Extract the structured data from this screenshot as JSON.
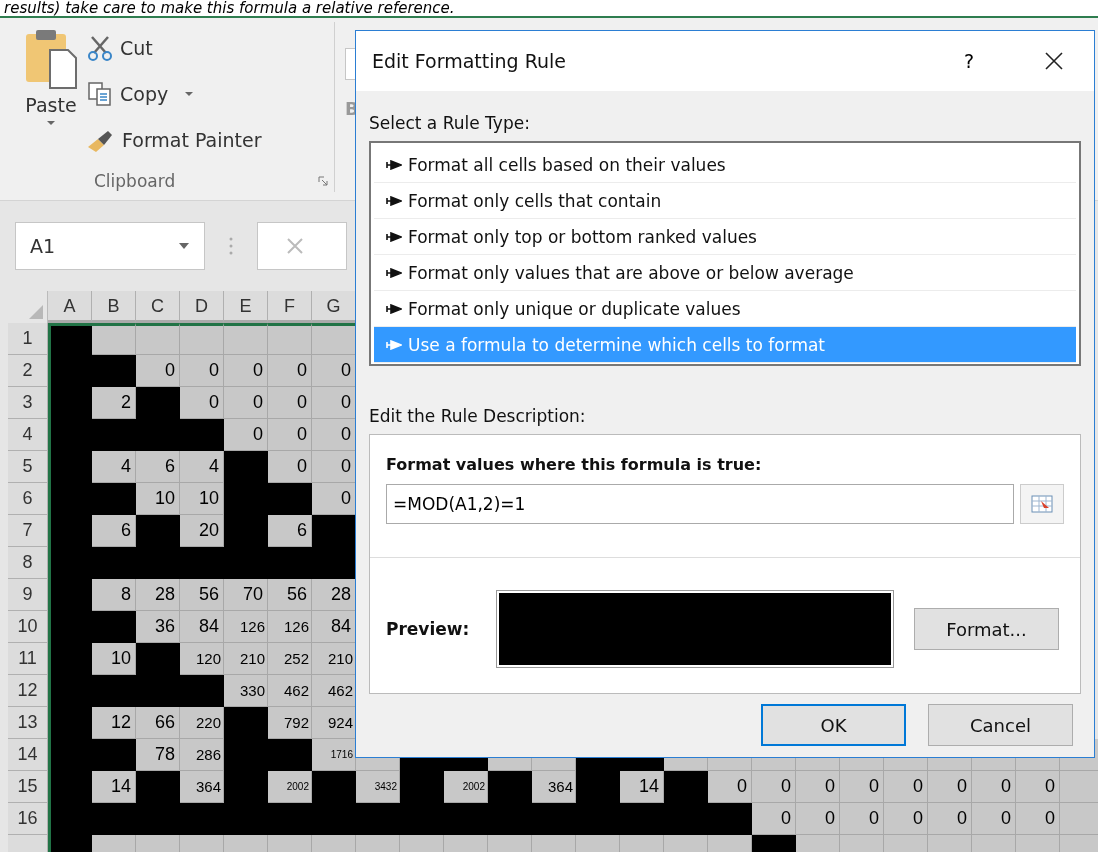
{
  "caption": "results) take care to make this formula a relative reference.",
  "ribbon": {
    "paste": "Paste",
    "cut": "Cut",
    "copy": "Copy",
    "format_painter": "Format Painter",
    "group_label": "Clipboard",
    "next_group_button": "B"
  },
  "name_box": {
    "value": "A1"
  },
  "sheet": {
    "columns": [
      "A",
      "B",
      "C",
      "D",
      "E",
      "F",
      "G"
    ],
    "rows": [
      {
        "header": "1",
        "cells": [
          {
            "filled": true
          },
          {
            "filled": false
          },
          {
            "filled": false
          },
          {
            "filled": false
          },
          {
            "filled": false
          },
          {
            "filled": false
          },
          {
            "filled": false
          }
        ]
      },
      {
        "header": "2",
        "cells": [
          {
            "filled": true
          },
          {
            "filled": true
          },
          {
            "filled": false,
            "value": "0"
          },
          {
            "filled": false,
            "value": "0"
          },
          {
            "filled": false,
            "value": "0"
          },
          {
            "filled": false,
            "value": "0"
          },
          {
            "filled": false,
            "value": "0"
          }
        ]
      },
      {
        "header": "3",
        "cells": [
          {
            "filled": true
          },
          {
            "filled": false,
            "value": "2"
          },
          {
            "filled": true
          },
          {
            "filled": false,
            "value": "0"
          },
          {
            "filled": false,
            "value": "0"
          },
          {
            "filled": false,
            "value": "0"
          },
          {
            "filled": false,
            "value": "0"
          }
        ]
      },
      {
        "header": "4",
        "cells": [
          {
            "filled": true
          },
          {
            "filled": true
          },
          {
            "filled": true
          },
          {
            "filled": true
          },
          {
            "filled": false,
            "value": "0"
          },
          {
            "filled": false,
            "value": "0"
          },
          {
            "filled": false,
            "value": "0"
          }
        ]
      },
      {
        "header": "5",
        "cells": [
          {
            "filled": true
          },
          {
            "filled": false,
            "value": "4"
          },
          {
            "filled": false,
            "value": "6"
          },
          {
            "filled": false,
            "value": "4"
          },
          {
            "filled": true
          },
          {
            "filled": false,
            "value": "0"
          },
          {
            "filled": false,
            "value": "0"
          }
        ]
      },
      {
        "header": "6",
        "cells": [
          {
            "filled": true
          },
          {
            "filled": true
          },
          {
            "filled": false,
            "value": "10"
          },
          {
            "filled": false,
            "value": "10"
          },
          {
            "filled": true
          },
          {
            "filled": true
          },
          {
            "filled": false,
            "value": "0"
          }
        ]
      },
      {
        "header": "7",
        "cells": [
          {
            "filled": true
          },
          {
            "filled": false,
            "value": "6"
          },
          {
            "filled": true
          },
          {
            "filled": false,
            "value": "20"
          },
          {
            "filled": true
          },
          {
            "filled": false,
            "value": "6"
          },
          {
            "filled": true
          }
        ]
      },
      {
        "header": "8",
        "cells": [
          {
            "filled": true
          },
          {
            "filled": true
          },
          {
            "filled": true
          },
          {
            "filled": true
          },
          {
            "filled": true
          },
          {
            "filled": true
          },
          {
            "filled": true
          }
        ]
      },
      {
        "header": "9",
        "cells": [
          {
            "filled": true
          },
          {
            "filled": false,
            "value": "8"
          },
          {
            "filled": false,
            "value": "28"
          },
          {
            "filled": false,
            "value": "56"
          },
          {
            "filled": false,
            "value": "70"
          },
          {
            "filled": false,
            "value": "56"
          },
          {
            "filled": false,
            "value": "28"
          }
        ]
      },
      {
        "header": "10",
        "cells": [
          {
            "filled": true
          },
          {
            "filled": true
          },
          {
            "filled": false,
            "value": "36"
          },
          {
            "filled": false,
            "value": "84"
          },
          {
            "filled": false,
            "value": "126"
          },
          {
            "filled": false,
            "value": "126"
          },
          {
            "filled": false,
            "value": "84"
          }
        ]
      },
      {
        "header": "11",
        "cells": [
          {
            "filled": true
          },
          {
            "filled": false,
            "value": "10"
          },
          {
            "filled": true
          },
          {
            "filled": false,
            "value": "120"
          },
          {
            "filled": false,
            "value": "210"
          },
          {
            "filled": false,
            "value": "252"
          },
          {
            "filled": false,
            "value": "210"
          }
        ]
      },
      {
        "header": "12",
        "cells": [
          {
            "filled": true
          },
          {
            "filled": true
          },
          {
            "filled": true
          },
          {
            "filled": true
          },
          {
            "filled": false,
            "value": "330"
          },
          {
            "filled": false,
            "value": "462"
          },
          {
            "filled": false,
            "value": "462"
          }
        ]
      },
      {
        "header": "13",
        "cells": [
          {
            "filled": true
          },
          {
            "filled": false,
            "value": "12"
          },
          {
            "filled": false,
            "value": "66"
          },
          {
            "filled": false,
            "value": "220"
          },
          {
            "filled": true
          },
          {
            "filled": false,
            "value": "792"
          },
          {
            "filled": false,
            "value": "924"
          }
        ]
      },
      {
        "header": "14",
        "cells": [
          {
            "filled": true
          },
          {
            "filled": true
          },
          {
            "filled": false,
            "value": "78"
          },
          {
            "filled": false,
            "value": "286"
          },
          {
            "filled": true
          },
          {
            "filled": true
          },
          {
            "filled": false,
            "value": "1716"
          },
          {
            "filled": false
          },
          {
            "filled": true
          },
          {
            "filled": true
          },
          {
            "filled": false
          },
          {
            "filled": false
          },
          {
            "filled": true
          },
          {
            "filled": true
          },
          {
            "filled": false
          },
          {
            "filled": false
          },
          {
            "filled": false
          },
          {
            "filled": false
          },
          {
            "filled": false
          },
          {
            "filled": false
          },
          {
            "filled": false
          },
          {
            "filled": false
          },
          {
            "filled": false
          },
          {
            "filled": false
          }
        ]
      },
      {
        "header": "15",
        "cells": [
          {
            "filled": true
          },
          {
            "filled": false,
            "value": "14"
          },
          {
            "filled": true
          },
          {
            "filled": false,
            "value": "364"
          },
          {
            "filled": true
          },
          {
            "filled": false,
            "value": "2002"
          },
          {
            "filled": true
          },
          {
            "filled": false,
            "value": "3432"
          },
          {
            "filled": true
          },
          {
            "filled": false,
            "value": "2002"
          },
          {
            "filled": true
          },
          {
            "filled": false,
            "value": "364"
          },
          {
            "filled": true
          },
          {
            "filled": false,
            "value": "14"
          },
          {
            "filled": true
          },
          {
            "filled": false,
            "value": "0"
          },
          {
            "filled": false,
            "value": "0"
          },
          {
            "filled": false,
            "value": "0"
          },
          {
            "filled": false,
            "value": "0"
          },
          {
            "filled": false,
            "value": "0"
          },
          {
            "filled": false,
            "value": "0"
          },
          {
            "filled": false,
            "value": "0"
          },
          {
            "filled": false,
            "value": "0"
          },
          {
            "filled": false
          }
        ]
      },
      {
        "header": "16",
        "cells": [
          {
            "filled": true
          },
          {
            "filled": true
          },
          {
            "filled": true
          },
          {
            "filled": true
          },
          {
            "filled": true
          },
          {
            "filled": true
          },
          {
            "filled": true
          },
          {
            "filled": true
          },
          {
            "filled": true
          },
          {
            "filled": true
          },
          {
            "filled": true
          },
          {
            "filled": true
          },
          {
            "filled": true
          },
          {
            "filled": true
          },
          {
            "filled": true
          },
          {
            "filled": true
          },
          {
            "filled": false,
            "value": "0"
          },
          {
            "filled": false,
            "value": "0"
          },
          {
            "filled": false,
            "value": "0"
          },
          {
            "filled": false,
            "value": "0"
          },
          {
            "filled": false,
            "value": "0"
          },
          {
            "filled": false,
            "value": "0"
          },
          {
            "filled": false,
            "value": "0"
          },
          {
            "filled": false
          }
        ]
      },
      {
        "cells": [
          {
            "filled": true
          },
          {
            "filled": false
          },
          {
            "filled": false
          },
          {
            "filled": false
          },
          {
            "filled": false
          },
          {
            "filled": false
          },
          {
            "filled": false
          },
          {
            "filled": false
          },
          {
            "filled": false
          },
          {
            "filled": false
          },
          {
            "filled": false
          },
          {
            "filled": false
          },
          {
            "filled": false
          },
          {
            "filled": false
          },
          {
            "filled": false
          },
          {
            "filled": false
          },
          {
            "filled": true
          },
          {
            "filled": false
          },
          {
            "filled": false
          },
          {
            "filled": false
          },
          {
            "filled": false
          },
          {
            "filled": false
          },
          {
            "filled": false
          },
          {
            "filled": false
          }
        ]
      }
    ]
  },
  "dialog": {
    "title": "Edit Formatting Rule",
    "help": "?",
    "rule_type_label": "Select a Rule Type:",
    "rule_types": [
      {
        "label": "Format all cells based on their values",
        "selected": false
      },
      {
        "label": "Format only cells that contain",
        "selected": false
      },
      {
        "label": "Format only top or bottom ranked values",
        "selected": false
      },
      {
        "label": "Format only values that are above or below average",
        "selected": false
      },
      {
        "label": "Format only unique or duplicate values",
        "selected": false
      },
      {
        "label": "Use a formula to determine which cells to format",
        "selected": true
      }
    ],
    "description_label": "Edit the Rule Description:",
    "formula_label": "Format values where this formula is true:",
    "formula": "=MOD(A1,2)=1",
    "preview_label": "Preview:",
    "format_button": "Format...",
    "buttons": [
      {
        "label": "OK",
        "default": true
      },
      {
        "label": "Cancel",
        "default": false
      }
    ]
  }
}
